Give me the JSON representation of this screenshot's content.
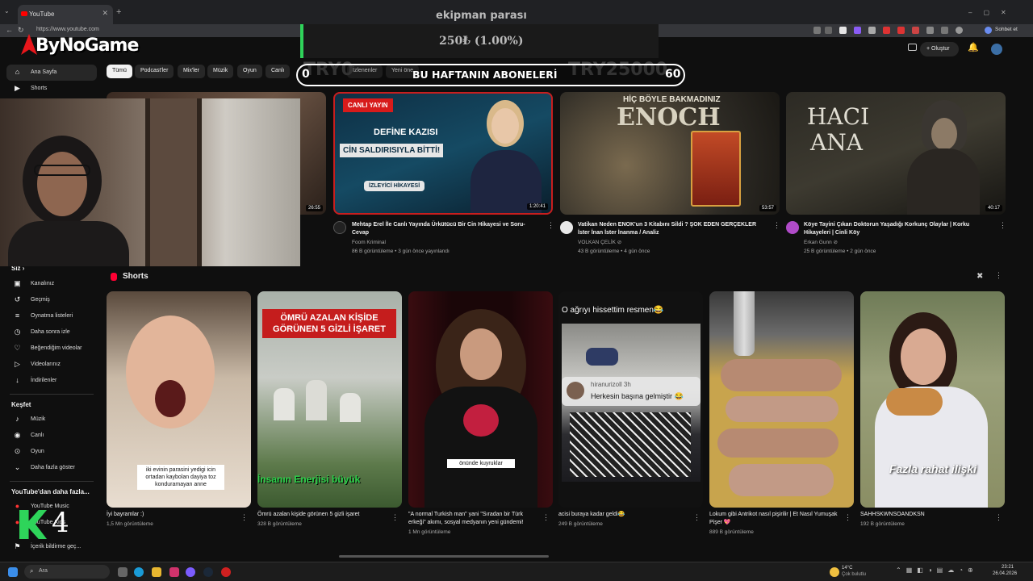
{
  "browser": {
    "tab_title": "YouTube",
    "url": "https://www.youtube.com",
    "profile_label": "Sohbet et"
  },
  "overlay": {
    "logo_text": "ByNoGame",
    "goal_title": "ekipman parası",
    "goal_amount": "250₺ (1.00%)",
    "goal_progress": 0.01,
    "goal_left": "0",
    "goal_right": "TRY25000",
    "goal_left_ghost": "TRY0",
    "subs_title": "BU HAFTANIN ABONELERİ",
    "subs_count": "60",
    "logo_k4": "4"
  },
  "header": {
    "create_label": "Oluştur"
  },
  "chips": [
    "Tümü",
    "Podcast'ler",
    "Mix'ler",
    "Müzik",
    "Oyun",
    "Canlı",
    "İzlenenler",
    "Yeni öne"
  ],
  "sidebar": {
    "top": [
      {
        "label": "Ana Sayfa",
        "icon": "home-icon"
      },
      {
        "label": "Shorts",
        "icon": "shorts-icon"
      }
    ],
    "you_heading": "Siz",
    "you": [
      {
        "label": "Kanalınız",
        "icon": "channel-icon"
      },
      {
        "label": "Geçmiş",
        "icon": "history-icon"
      },
      {
        "label": "Oynatma listeleri",
        "icon": "playlist-icon"
      },
      {
        "label": "Daha sonra izle",
        "icon": "clock-icon"
      },
      {
        "label": "Beğendiğim videolar",
        "icon": "like-icon"
      },
      {
        "label": "Videolarınız",
        "icon": "video-icon"
      },
      {
        "label": "İndirilenler",
        "icon": "download-icon"
      }
    ],
    "explore_heading": "Keşfet",
    "explore": [
      {
        "label": "Müzik",
        "icon": "music-icon"
      },
      {
        "label": "Canlı",
        "icon": "live-icon"
      },
      {
        "label": "Oyun",
        "icon": "game-icon"
      },
      {
        "label": "Daha fazla göster",
        "icon": "chevron-down-icon"
      }
    ],
    "more_heading": "YouTube'dan daha fazla...",
    "more": [
      {
        "label": "YouTube Music"
      },
      {
        "label": "YouTube Kids"
      }
    ],
    "report_label": "İçerik bildirme geç..."
  },
  "videos": [
    {
      "duration": "26:55"
    },
    {
      "thumb_badge": "CANLI YAYIN",
      "thumb_line1": "DEFİNE KAZISI",
      "thumb_line2": "CİN SALDIRISIYLA BİTTİ!",
      "thumb_tag": "İZLEYİCİ HİKAYESİ",
      "duration": "1:20:41",
      "title": "Mehtap Erel İle Canlı Yayında Ürkütücü Bir Cin Hikayesi ve Soru-Cevap",
      "channel": "Foom Kriminal",
      "meta": "86 B görüntüleme • 3 gün önce yayınlandı",
      "avatar_color": "#222"
    },
    {
      "thumb_line1": "HİÇ BÖYLE BAKMADINIZ",
      "thumb_line2": "ENOCH",
      "duration": "53:57",
      "title": "Vatikan Neden ENOK'un 3 Kitabını Sildi ? ŞOK EDEN GERÇEKLER İster İnan İster İnanma / Analiz",
      "channel": "VOLKAN ÇELİK ⊘",
      "meta": "43 B görüntüleme • 4 gün önce",
      "avatar_color": "#ddd"
    },
    {
      "thumb_line1": "HACI",
      "thumb_line2": "ANA",
      "duration": "40:17",
      "title": "Köye Tayini Çıkan Doktorun Yaşadığı Korkunç Olaylar | Korku Hikayeleri | Cinli Köy",
      "channel": "Erkan Gunn ⊘",
      "meta": "25 B görüntüleme • 2 gün önce",
      "avatar_color": "#b04bc8"
    }
  ],
  "shorts": {
    "heading": "Shorts",
    "items": [
      {
        "caption": "iki evinin parasini yedigi icin ortadan kaybolan dayiya toz konduramayan anne",
        "title": "İyi bayramlar :)",
        "views": "1,5 Mn görüntüleme"
      },
      {
        "caption_top": "ÖMRÜ AZALAN KİŞİDE GÖRÜNEN 5 GİZLİ İŞARET",
        "caption_bottom": "İnsanın Enerjisi büyük",
        "title": "Ömrü azalan kişide görünen 5 gizli işaret",
        "views": "328 B görüntüleme"
      },
      {
        "caption": "önünde kuyruklar",
        "title": "\"A normal Turkish man\" yani \"Sıradan bir Türk erkeği\" akımı, sosyal medyanın yeni gündemi!",
        "views": "1 Mn görüntüleme"
      },
      {
        "caption_top": "O ağrıyı hissettim resmen😂",
        "comment_user": "hiranurizoll 3h",
        "comment_text": "Herkesin başına gelmiştir 😂",
        "title": "acisi buraya kadar geldi😂",
        "views": "249 B görüntüleme"
      },
      {
        "title": "Lokum gibi Antrikot nasıl pişirilir | Et Nasıl Yumuşak Pişer 💖",
        "views": "889 B görüntüleme"
      },
      {
        "caption": "Fazla rahat ilişki",
        "title": "SAHHSKWNSOANDKSN",
        "views": "192 B görüntüleme"
      }
    ]
  },
  "taskbar": {
    "search_placeholder": "Ara",
    "weather": "14°C",
    "weather_desc": "Çok bulutlu",
    "time": "23:21",
    "date": "26.04.2026"
  }
}
